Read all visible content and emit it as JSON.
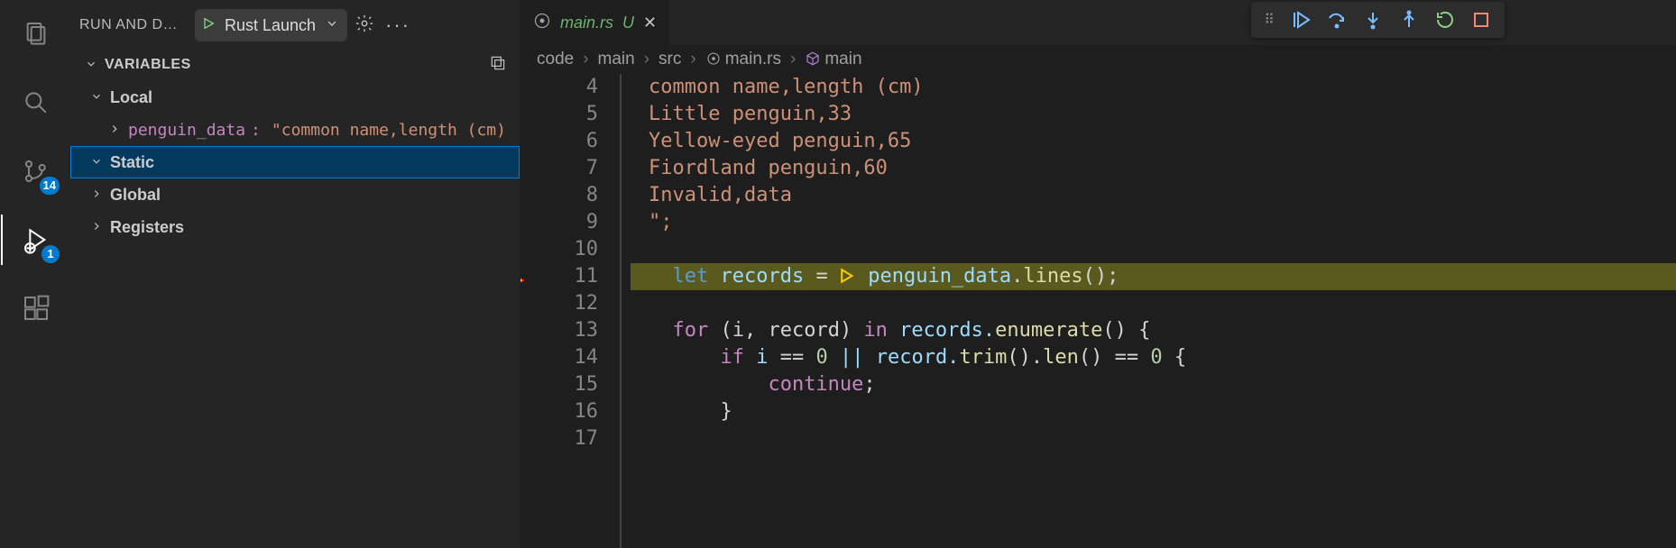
{
  "activity": {
    "scm_badge": "14",
    "debug_badge": "1"
  },
  "sidebar": {
    "title": "RUN AND D…",
    "config": "Rust Launch",
    "section": "VARIABLES",
    "scopes": {
      "local": "Local",
      "static": "Static",
      "global": "Global",
      "registers": "Registers"
    },
    "var": {
      "name": "penguin_data",
      "sep": ":",
      "value": "\"common name,length (cm)"
    }
  },
  "tab": {
    "filename": "main.rs",
    "status": "U"
  },
  "breadcrumb": {
    "p0": "code",
    "p1": "main",
    "p2": "src",
    "p3": "main.rs",
    "p4": "main"
  },
  "gutter": {
    "l4": "4",
    "l5": "5",
    "l6": "6",
    "l7": "7",
    "l8": "8",
    "l9": "9",
    "l10": "10",
    "l11": "11",
    "l12": "12",
    "l13": "13",
    "l14": "14",
    "l15": "15",
    "l16": "16",
    "l17": "17"
  },
  "code": {
    "l4": "common name,length (cm)",
    "l5": "Little penguin,33",
    "l6": "Yellow-eyed penguin,65",
    "l7": "Fiordland penguin,60",
    "l8": "Invalid,data",
    "l9": "\";",
    "l11_let": "let",
    "l11_var": " records ",
    "l11_eq": "= ",
    "l11_rhs_a": "penguin_data",
    "l11_rhs_b": ".",
    "l11_rhs_fn": "lines",
    "l11_rhs_c": "();",
    "l13_for": "for",
    "l13_a": " (i, record) ",
    "l13_in": "in",
    "l13_b": " records.",
    "l13_fn": "enumerate",
    "l13_c": "() {",
    "l14_if": "if",
    "l14_a": " i ",
    "l14_eq": "==",
    "l14_b": " ",
    "l14_zero": "0",
    "l14_c": " || record.",
    "l14_fn1": "trim",
    "l14_d": "().",
    "l14_fn2": "len",
    "l14_e": "() ",
    "l14_eq2": "==",
    "l14_f": " ",
    "l14_zero2": "0",
    "l14_g": " {",
    "l15_kw": "continue",
    "l15_sc": ";",
    "l16": "}"
  }
}
